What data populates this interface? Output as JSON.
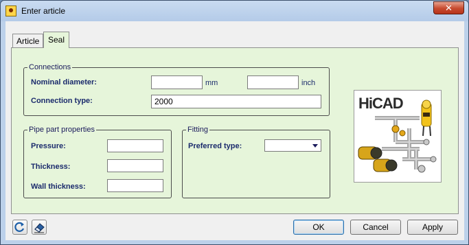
{
  "window": {
    "title": "Enter article",
    "close_glyph": "✕"
  },
  "tabs": [
    {
      "label": "Article",
      "active": false
    },
    {
      "label": "Seal",
      "active": true
    }
  ],
  "connections": {
    "legend": "Connections",
    "nominal_label": "Nominal diameter:",
    "mm_value": "",
    "mm_unit": "mm",
    "inch_value": "",
    "inch_unit": "inch",
    "type_label": "Connection type:",
    "type_value": "2000"
  },
  "pipe_props": {
    "legend": "Pipe part properties",
    "pressure_label": "Pressure:",
    "pressure_value": "",
    "thickness_label": "Thickness:",
    "thickness_value": "",
    "wall_label": "Wall thickness:",
    "wall_value": ""
  },
  "fitting": {
    "legend": "Fitting",
    "preferred_label": "Preferred type:",
    "preferred_value": ""
  },
  "logo": {
    "text": "HiCAD"
  },
  "buttons": {
    "ok": "OK",
    "cancel": "Cancel",
    "apply": "Apply"
  },
  "icons": {
    "refresh": "refresh-icon",
    "eraser": "eraser-icon",
    "app": "hicad-app-icon"
  },
  "colors": {
    "panel_bg": "#e6f5da",
    "frame_bg": "#bcd1ea",
    "label_color": "#1a2a6c",
    "close_red": "#c74a2f"
  }
}
